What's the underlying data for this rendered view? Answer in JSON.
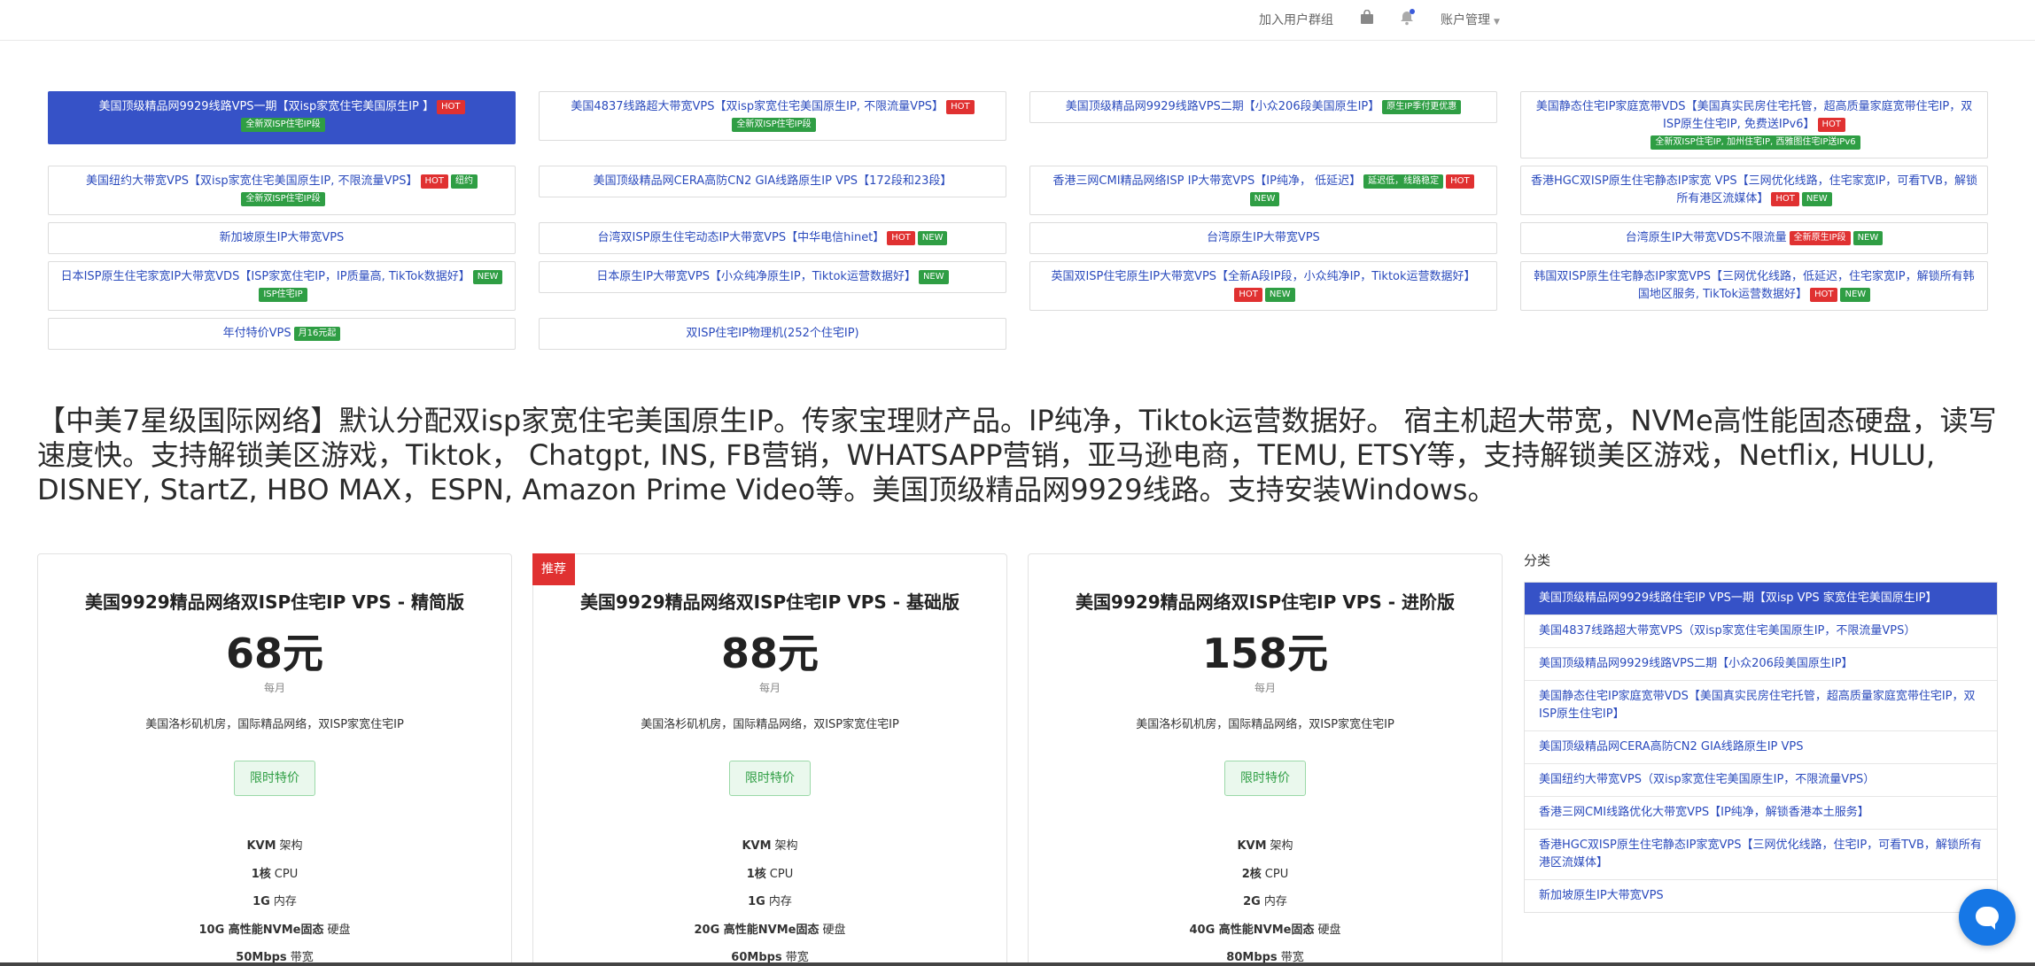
{
  "topbar": {
    "join_group": "加入用户群组",
    "account": "账户管理",
    "icons": [
      "shopping-bag-icon",
      "bell-icon"
    ]
  },
  "categories": [
    {
      "label": "美国顶级精品网9929线路VPS一期【双isp家宽住宅美国原生IP 】",
      "badges": [
        "HOT"
      ],
      "extra": [
        "全新双ISP住宅IP段"
      ],
      "active": true
    },
    {
      "label": "美国4837线路超大带宽VPS【双isp家宽住宅美国原生IP, 不限流量VPS】",
      "badges": [
        "HOT"
      ],
      "extra": [
        "全新双ISP住宅IP段"
      ],
      "active": false
    },
    {
      "label": "美国顶级精品网9929线路VPS二期【小众206段美国原生IP】",
      "badges": [
        "原生IP季付更优惠"
      ],
      "extra": [],
      "active": false
    },
    {
      "label": "美国静态住宅IP家庭宽带VDS【美国真实民房住宅托管，超高质量家庭宽带住宅IP，双ISP原生住宅IP, 免费送IPv6】",
      "badges": [
        "HOT"
      ],
      "extra": [
        "全新双ISP住宅IP, 加州住宅IP, 西雅图住宅IP送IPv6"
      ],
      "active": false
    },
    {
      "label": "美国纽约大带宽VPS【双isp家宽住宅美国原生IP, 不限流量VPS】",
      "badges": [
        "HOT",
        "纽约"
      ],
      "extra": [
        "全新双ISP住宅IP段"
      ],
      "active": false
    },
    {
      "label": "美国顶级精品网CERA高防CN2 GIA线路原生IP VPS【172段和23段】",
      "badges": [],
      "extra": [],
      "active": false
    },
    {
      "label": "香港三网CMI精品网络ISP IP大带宽VPS【IP纯净， 低延迟】",
      "badges": [
        "延迟低，线路稳定",
        "HOT",
        "NEW"
      ],
      "extra": [],
      "active": false
    },
    {
      "label": "香港HGC双ISP原生住宅静态IP家宽 VPS【三网优化线路，住宅家宽IP，可看TVB，解锁所有港区流媒体】",
      "badges": [
        "HOT",
        "NEW"
      ],
      "extra": [],
      "active": false
    },
    {
      "label": "新加坡原生IP大带宽VPS",
      "badges": [],
      "extra": [],
      "active": false
    },
    {
      "label": "台湾双ISP原生住宅动态IP大带宽VPS【中华电信hinet】",
      "badges": [
        "HOT",
        "NEW"
      ],
      "extra": [],
      "active": false
    },
    {
      "label": "台湾原生IP大带宽VPS",
      "badges": [],
      "extra": [],
      "active": false
    },
    {
      "label": "台湾原生IP大带宽VDS不限流量",
      "badges": [
        "全新原生IP段",
        "NEW"
      ],
      "extra": [],
      "active": false
    },
    {
      "label": "日本ISP原生住宅家宽IP大带宽VDS【ISP家宽住宅IP，IP质量高, TikTok数据好】",
      "badges": [
        "NEW",
        "ISP住宅IP"
      ],
      "extra": [],
      "active": false
    },
    {
      "label": "日本原生IP大带宽VPS【小众纯净原生IP，Tiktok运营数据好】",
      "badges": [
        "NEW"
      ],
      "extra": [],
      "active": false
    },
    {
      "label": "英国双ISP住宅原生IP大带宽VPS【全新A段IP段，小众纯净IP，Tiktok运营数据好】",
      "badges": [
        "HOT",
        "NEW"
      ],
      "extra": [],
      "active": false
    },
    {
      "label": "韩国双ISP原生住宅静态IP家宽VPS【三网优化线路，低延迟，住宅家宽IP，解锁所有韩国地区服务, TikTok运营数据好】",
      "badges": [
        "HOT",
        "NEW"
      ],
      "extra": [],
      "active": false
    },
    {
      "label": "年付特价VPS",
      "badges": [
        "月16元起"
      ],
      "extra": [],
      "active": false
    },
    {
      "label": "双ISP住宅IP物理机(252个住宅IP)",
      "badges": [],
      "extra": [],
      "active": false
    }
  ],
  "description": "【中美7星级国际网络】默认分配双isp家宽住宅美国原生IP。传家宝理财产品。IP纯净，Tiktok运营数据好。 宿主机超大带宽，NVMe高性能固态硬盘，读写速度快。支持解锁美区游戏，Tiktok， Chatgpt, INS, FB营销，WHATSAPP营销，亚马逊电商，TEMU, ETSY等，支持解锁美区游戏，Netflix, HULU, DISNEY, StartZ, HBO MAX，ESPN, Amazon Prime Video等。美国顶级精品网9929线路。支持安装Windows。",
  "products": [
    {
      "title": "美国9929精品网络双ISP住宅IP VPS - 精简版",
      "price": "68元",
      "period": "每月",
      "location": "美国洛杉矶机房，国际精品网络，双ISP家宽住宅IP",
      "promo": "限时特价",
      "ribbon": "",
      "specs": [
        {
          "v": "KVM",
          "l": "架构"
        },
        {
          "v": "1核",
          "l": "CPU"
        },
        {
          "v": "1G",
          "l": "内存"
        },
        {
          "v": "10G 高性能NVMe固态",
          "l": "硬盘"
        },
        {
          "v": "50Mbps",
          "l": "带宽"
        }
      ]
    },
    {
      "title": "美国9929精品网络双ISP住宅IP VPS - 基础版",
      "price": "88元",
      "period": "每月",
      "location": "美国洛杉矶机房，国际精品网络，双ISP家宽住宅IP",
      "promo": "限时特价",
      "ribbon": "推荐",
      "specs": [
        {
          "v": "KVM",
          "l": "架构"
        },
        {
          "v": "1核",
          "l": "CPU"
        },
        {
          "v": "1G",
          "l": "内存"
        },
        {
          "v": "20G 高性能NVMe固态",
          "l": "硬盘"
        },
        {
          "v": "60Mbps",
          "l": "带宽"
        }
      ]
    },
    {
      "title": "美国9929精品网络双ISP住宅IP VPS - 进阶版",
      "price": "158元",
      "period": "每月",
      "location": "美国洛杉矶机房，国际精品网络，双ISP家宽住宅IP",
      "promo": "限时特价",
      "ribbon": "",
      "specs": [
        {
          "v": "KVM",
          "l": "架构"
        },
        {
          "v": "2核",
          "l": "CPU"
        },
        {
          "v": "2G",
          "l": "内存"
        },
        {
          "v": "40G 高性能NVMe固态",
          "l": "硬盘"
        },
        {
          "v": "80Mbps",
          "l": "带宽"
        }
      ]
    }
  ],
  "sidebar": {
    "title": "分类",
    "items": [
      {
        "label": "美国顶级精品网9929线路住宅IP VPS一期【双isp VPS 家宽住宅美国原生IP】",
        "active": true
      },
      {
        "label": "美国4837线路超大带宽VPS（双isp家宽住宅美国原生IP，不限流量VPS）",
        "active": false
      },
      {
        "label": "美国顶级精品网9929线路VPS二期【小众206段美国原生IP】",
        "active": false
      },
      {
        "label": "美国静态住宅IP家庭宽带VDS【美国真实民房住宅托管，超高质量家庭宽带住宅IP，双ISP原生住宅IP】",
        "active": false
      },
      {
        "label": "美国顶级精品网CERA高防CN2 GIA线路原生IP VPS",
        "active": false
      },
      {
        "label": "美国纽约大带宽VPS（双isp家宽住宅美国原生IP，不限流量VPS）",
        "active": false
      },
      {
        "label": "香港三网CMI线路优化大带宽VPS【IP纯净，解锁香港本土服务】",
        "active": false
      },
      {
        "label": "香港HGC双ISP原生住宅静态IP家宽VPS【三网优化线路，住宅IP，可看TVB，解锁所有港区流媒体】",
        "active": false
      },
      {
        "label": "新加坡原生IP大带宽VPS",
        "active": false
      }
    ]
  },
  "colors": {
    "accent": "#3652c7",
    "link": "#2b4bbd",
    "hot": "#e03131",
    "new": "#2f9e44",
    "chat": "#1677e6"
  }
}
